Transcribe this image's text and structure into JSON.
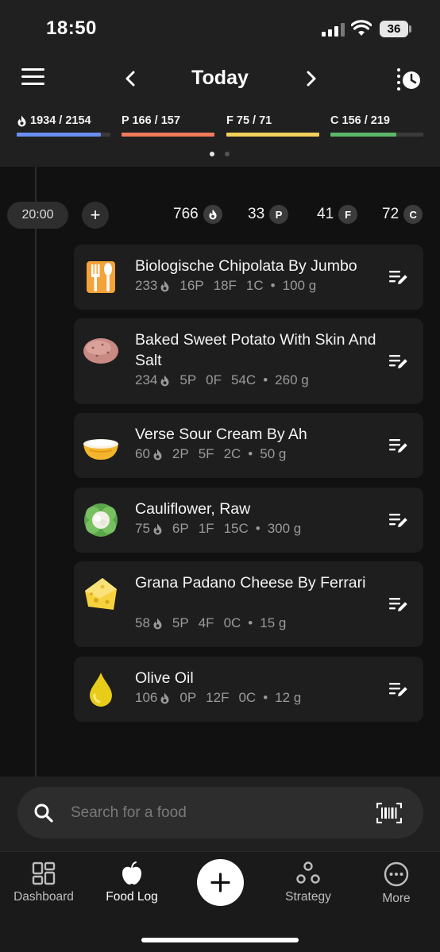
{
  "status_bar": {
    "time": "18:50",
    "battery": "36"
  },
  "nav": {
    "title": "Today",
    "menu_icon": "hamburger-menu-icon",
    "prev_icon": "chevron-left-icon",
    "next_icon": "chevron-right-icon",
    "history_icon": "history-clock-icon"
  },
  "macros": [
    {
      "key": "calories",
      "label": "1934 / 2154",
      "icon": "flame-icon",
      "fraction": 0.898,
      "color": "#6a8ff0"
    },
    {
      "key": "protein",
      "label": "P 166 / 157",
      "fraction": 1.0,
      "color": "#f07a5a"
    },
    {
      "key": "fat",
      "label": "F 75 / 71",
      "fraction": 1.0,
      "color": "#f2d15a"
    },
    {
      "key": "carbs",
      "label": "C 156 / 219",
      "fraction": 0.712,
      "color": "#5cb86a"
    }
  ],
  "page_dots": {
    "count": 2,
    "active": 0
  },
  "meal": {
    "time": "20:00",
    "add_label": "+",
    "calories": "766",
    "protein": "33",
    "fat": "41",
    "carbs": "72",
    "badge_p": "P",
    "badge_f": "F",
    "badge_c": "C"
  },
  "foods": [
    {
      "name": "Biologische Chipolata By Jumbo",
      "cal": "233",
      "p": "16P",
      "f": "18F",
      "c": "1C",
      "amount": "100 g",
      "icon": "fork-knife-icon"
    },
    {
      "name": "Baked Sweet Potato With Skin And Salt",
      "cal": "234",
      "p": "5P",
      "f": "0F",
      "c": "54C",
      "amount": "260 g",
      "icon": "potato-icon"
    },
    {
      "name": "Verse Sour Cream By Ah",
      "cal": "60",
      "p": "2P",
      "f": "5F",
      "c": "2C",
      "amount": "50 g",
      "icon": "bowl-icon"
    },
    {
      "name": "Cauliflower, Raw",
      "cal": "75",
      "p": "6P",
      "f": "1F",
      "c": "15C",
      "amount": "300 g",
      "icon": "cauliflower-icon"
    },
    {
      "name": "Grana Padano Cheese By Ferrari",
      "cal": "58",
      "p": "5P",
      "f": "4F",
      "c": "0C",
      "amount": "15 g",
      "icon": "cheese-icon"
    },
    {
      "name": "Olive Oil",
      "cal": "106",
      "p": "0P",
      "f": "12F",
      "c": "0C",
      "amount": "12 g",
      "icon": "oil-drop-icon"
    }
  ],
  "search": {
    "placeholder": "Search for a food"
  },
  "tabs": [
    {
      "label": "Dashboard",
      "icon": "dashboard-icon"
    },
    {
      "label": "Food Log",
      "icon": "apple-icon"
    },
    {
      "label": "Strategy",
      "icon": "strategy-icon"
    },
    {
      "label": "More",
      "icon": "more-icon"
    }
  ]
}
